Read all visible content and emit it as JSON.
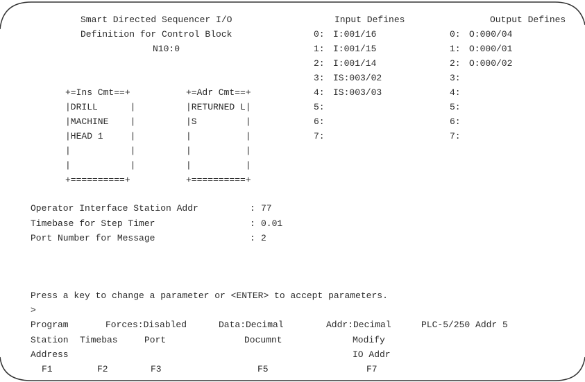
{
  "title": {
    "line1": "Smart Directed Sequencer I/O",
    "line2": "Definition for Control Block",
    "block": "N10:0"
  },
  "input_defines": {
    "header": "Input Defines",
    "rows": [
      {
        "index": "0:",
        "value": "I:001/16"
      },
      {
        "index": "1:",
        "value": "I:001/15"
      },
      {
        "index": "2:",
        "value": "I:001/14"
      },
      {
        "index": "3:",
        "value": "IS:003/02"
      },
      {
        "index": "4:",
        "value": "IS:003/03"
      },
      {
        "index": "5:",
        "value": ""
      },
      {
        "index": "6:",
        "value": ""
      },
      {
        "index": "7:",
        "value": ""
      }
    ]
  },
  "output_defines": {
    "header": "Output Defines",
    "rows": [
      {
        "index": "0:",
        "value": "O:000/04"
      },
      {
        "index": "1:",
        "value": "O:000/01"
      },
      {
        "index": "2:",
        "value": "O:000/02"
      },
      {
        "index": "3:",
        "value": ""
      },
      {
        "index": "4:",
        "value": ""
      },
      {
        "index": "5:",
        "value": ""
      },
      {
        "index": "6:",
        "value": ""
      },
      {
        "index": "7:",
        "value": ""
      }
    ]
  },
  "ins_cmt_box": {
    "top": "+=Ins Cmt==+",
    "lines": [
      "|DRILL      |",
      "|MACHINE    |",
      "|HEAD 1     |",
      "|           |",
      "|           |"
    ],
    "bottom": "+==========+"
  },
  "adr_cmt_box": {
    "top": "+=Adr Cmt==+",
    "lines": [
      "|RETURNED L|",
      "|S         |",
      "|          |",
      "|          |",
      "|          |"
    ],
    "bottom": "+==========+"
  },
  "params": [
    {
      "label": "Operator Interface Station Addr",
      "sep": ":",
      "value": "77"
    },
    {
      "label": "Timebase for Step Timer",
      "sep": ":",
      "value": "0.01"
    },
    {
      "label": "Port Number for Message",
      "sep": ":",
      "value": "2"
    }
  ],
  "prompt": {
    "message": "Press a key to change a parameter or <ENTER> to accept parameters.",
    "cursor": ">"
  },
  "status": {
    "mode": "Program",
    "forces": "Forces:Disabled",
    "data": "Data:Decimal",
    "addr": "Addr:Decimal",
    "plc": "PLC-5/250 Addr 5"
  },
  "fkeys": [
    {
      "line1": "Station",
      "line2": "Address",
      "key": "F1"
    },
    {
      "line1": "Timebas",
      "line2": "",
      "key": "F2"
    },
    {
      "line1": "Port",
      "line2": "",
      "key": "F3"
    },
    {
      "line1": "Documnt",
      "line2": "",
      "key": "F5"
    },
    {
      "line1": "Modify",
      "line2": "IO Addr",
      "key": "F7"
    }
  ]
}
